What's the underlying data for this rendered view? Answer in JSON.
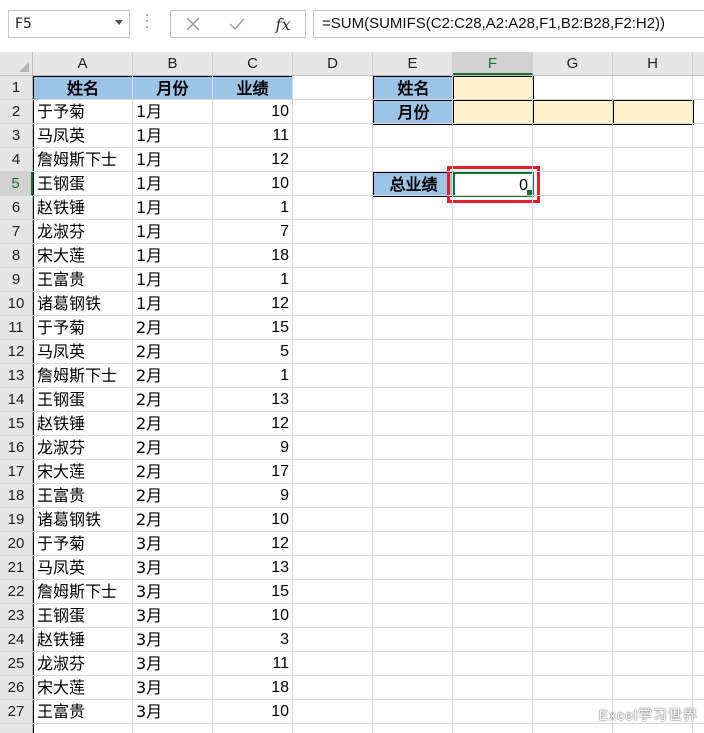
{
  "name_box": "F5",
  "formula_bar": {
    "cancel_icon": "close-x-icon",
    "enter_icon": "checkmark-icon",
    "fx_label": "fx",
    "formula": "=SUM(SUMIFS(C2:C28,A2:A28,F1,B2:B28,F2:H2))"
  },
  "columns": [
    "A",
    "B",
    "C",
    "D",
    "E",
    "F",
    "G",
    "H"
  ],
  "selected_column": "F",
  "selected_row": "5",
  "rows": [
    "1",
    "2",
    "3",
    "4",
    "5",
    "6",
    "7",
    "8",
    "9",
    "10",
    "11",
    "12",
    "13",
    "14",
    "15",
    "16",
    "17",
    "18",
    "19",
    "20",
    "21",
    "22",
    "23",
    "24",
    "25",
    "26",
    "27"
  ],
  "table": {
    "headers": [
      "姓名",
      "月份",
      "业绩"
    ],
    "records": [
      [
        "于予菊",
        "1月",
        "10"
      ],
      [
        "马凤英",
        "1月",
        "11"
      ],
      [
        "詹姆斯下士",
        "1月",
        "12"
      ],
      [
        "王钢蛋",
        "1月",
        "10"
      ],
      [
        "赵铁锤",
        "1月",
        "1"
      ],
      [
        "龙淑芬",
        "1月",
        "7"
      ],
      [
        "宋大莲",
        "1月",
        "18"
      ],
      [
        "王富贵",
        "1月",
        "1"
      ],
      [
        "诸葛钢铁",
        "1月",
        "12"
      ],
      [
        "于予菊",
        "2月",
        "15"
      ],
      [
        "马凤英",
        "2月",
        "5"
      ],
      [
        "詹姆斯下士",
        "2月",
        "1"
      ],
      [
        "王钢蛋",
        "2月",
        "13"
      ],
      [
        "赵铁锤",
        "2月",
        "12"
      ],
      [
        "龙淑芬",
        "2月",
        "9"
      ],
      [
        "宋大莲",
        "2月",
        "17"
      ],
      [
        "王富贵",
        "2月",
        "9"
      ],
      [
        "诸葛钢铁",
        "2月",
        "10"
      ],
      [
        "于予菊",
        "3月",
        "12"
      ],
      [
        "马凤英",
        "3月",
        "13"
      ],
      [
        "詹姆斯下士",
        "3月",
        "15"
      ],
      [
        "王钢蛋",
        "3月",
        "10"
      ],
      [
        "赵铁锤",
        "3月",
        "3"
      ],
      [
        "龙淑芬",
        "3月",
        "11"
      ],
      [
        "宋大莲",
        "3月",
        "18"
      ],
      [
        "王富贵",
        "3月",
        "10"
      ]
    ]
  },
  "criteria": {
    "name_label": "姓名",
    "month_label": "月份",
    "total_label": "总业绩",
    "total_value": "0"
  },
  "colors": {
    "header_fill": "#9dc3e6",
    "input_fill": "#fff2cc",
    "highlight_border": "#e0202a",
    "selection": "#1e6b3c"
  },
  "watermark": "Excel学习世界"
}
